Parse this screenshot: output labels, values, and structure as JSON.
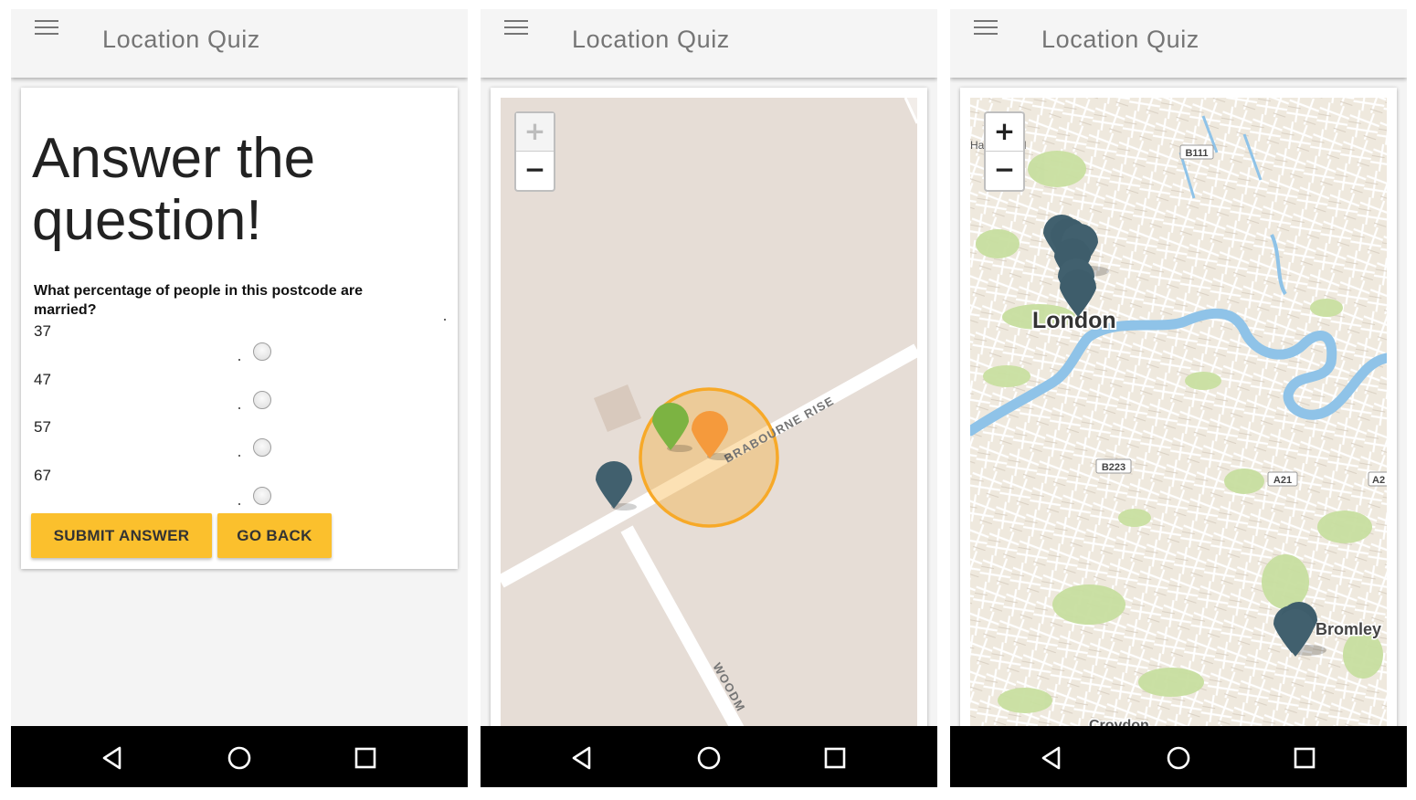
{
  "app": {
    "title": "Location Quiz"
  },
  "quiz": {
    "heading": "Answer the question!",
    "question": "What percentage of people in this postcode are married?",
    "options": [
      {
        "label": "37"
      },
      {
        "label": "47"
      },
      {
        "label": "57"
      },
      {
        "label": "67"
      }
    ],
    "submit_label": "SUBMIT ANSWER",
    "back_label": "GO BACK"
  },
  "map_detail": {
    "zoom_in": "+",
    "zoom_out": "−",
    "street_labels": [
      "BRABOURNE RISE",
      "WOODM"
    ],
    "marker_colors": {
      "correct": "#7cb342",
      "user": "#f59a3c",
      "other": "#41606e",
      "circle": "#f7a928"
    }
  },
  "map_city": {
    "zoom_in": "+",
    "zoom_out": "−",
    "place_labels": [
      "London",
      "Bromley",
      "Croydon",
      "Hampstead"
    ],
    "road_labels": [
      "B111",
      "B223",
      "A21",
      "A2"
    ],
    "colors": {
      "land": "#efe9de",
      "park": "#c8dfa0",
      "water": "#8fc3e8",
      "marker": "#41606e"
    }
  },
  "navigation": {
    "back": "back-icon",
    "home": "home-icon",
    "recent": "recent-apps-icon"
  }
}
